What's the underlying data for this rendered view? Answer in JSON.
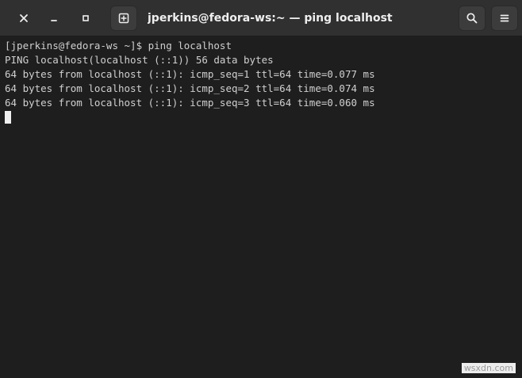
{
  "window": {
    "title": "jperkins@fedora-ws:~ — ping localhost"
  },
  "headerbar": {
    "buttons": [
      {
        "name": "close",
        "icon": "close-icon"
      },
      {
        "name": "minimize",
        "icon": "minimize-icon"
      },
      {
        "name": "maximize",
        "icon": "maximize-icon"
      },
      {
        "name": "new-tab",
        "icon": "new-tab-icon"
      },
      {
        "name": "search",
        "icon": "search-icon"
      },
      {
        "name": "menu",
        "icon": "hamburger-menu-icon"
      }
    ]
  },
  "terminal": {
    "lines": [
      "[jperkins@fedora-ws ~]$ ping localhost",
      "PING localhost(localhost (::1)) 56 data bytes",
      "64 bytes from localhost (::1): icmp_seq=1 ttl=64 time=0.077 ms",
      "64 bytes from localhost (::1): icmp_seq=2 ttl=64 time=0.074 ms",
      "64 bytes from localhost (::1): icmp_seq=3 ttl=64 time=0.060 ms"
    ]
  },
  "watermark": "wsxdn.com",
  "colors": {
    "headerbar": "#303030",
    "terminal_bg": "#1e1e1e",
    "terminal_fg": "#d0d0d0"
  }
}
